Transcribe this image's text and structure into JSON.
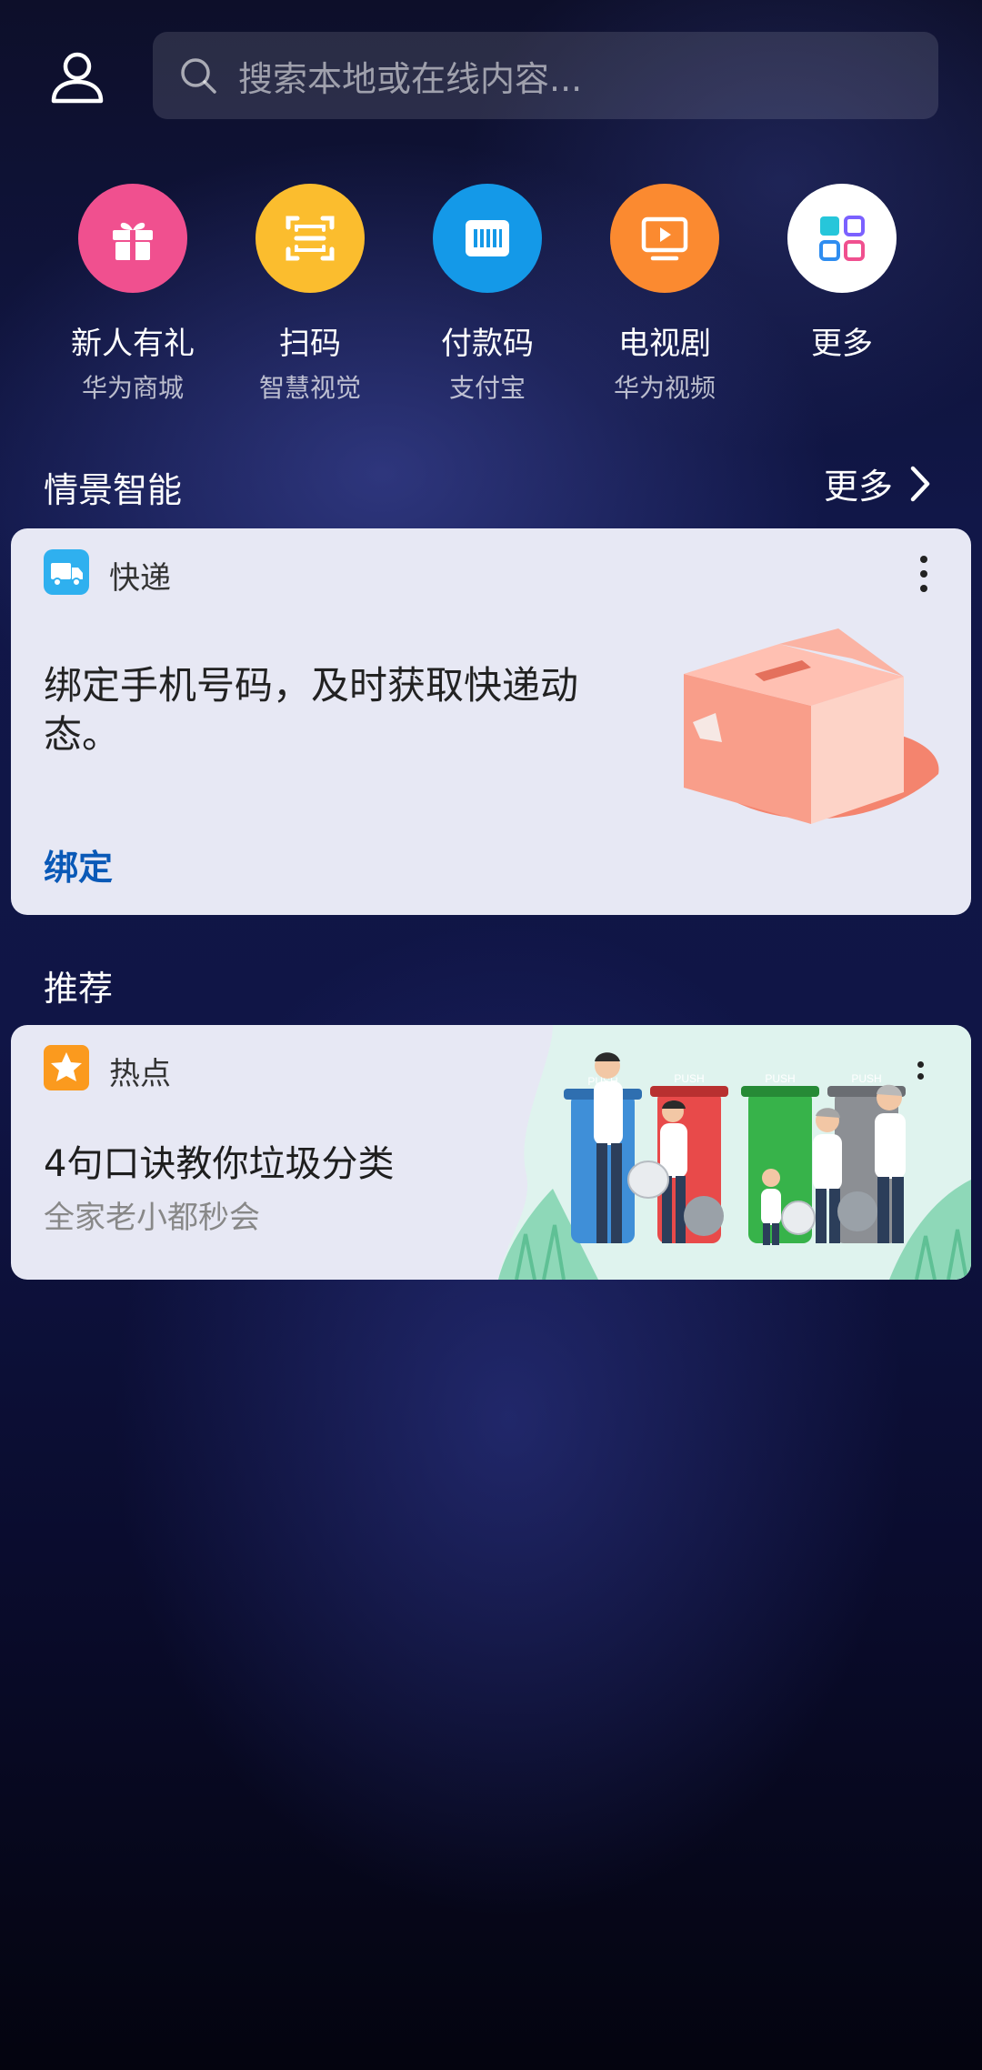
{
  "search": {
    "placeholder": "搜索本地或在线内容..."
  },
  "shortcuts": [
    {
      "label": "新人有礼",
      "sub": "华为商城",
      "icon": "gift-icon",
      "color": "#f0508f"
    },
    {
      "label": "扫码",
      "sub": "智慧视觉",
      "icon": "scan-icon",
      "color": "#fbbd2e"
    },
    {
      "label": "付款码",
      "sub": "支付宝",
      "icon": "barcode-icon",
      "color": "#1499e8"
    },
    {
      "label": "电视剧",
      "sub": "华为视频",
      "icon": "tv-play-icon",
      "color": "#fb8a30"
    },
    {
      "label": "更多",
      "sub": "",
      "icon": "apps-grid-icon",
      "color": "#ffffff"
    }
  ],
  "scene": {
    "title": "情景智能",
    "more_label": "更多",
    "express_card": {
      "label": "快递",
      "icon": "truck-icon",
      "text": "绑定手机号码，及时获取快递动态。",
      "bind_label": "绑定"
    }
  },
  "recommend": {
    "title": "推荐",
    "hot_card": {
      "label": "热点",
      "icon": "star-icon",
      "title": "4句口诀教你垃圾分类",
      "subtitle": "全家老小都秒会",
      "bin_labels": [
        "PUSH",
        "PUSH",
        "PUSH",
        "PUSH"
      ]
    }
  },
  "colors": {
    "bind_link": "#0a59b7",
    "card_bg": "#e7e8f4"
  }
}
